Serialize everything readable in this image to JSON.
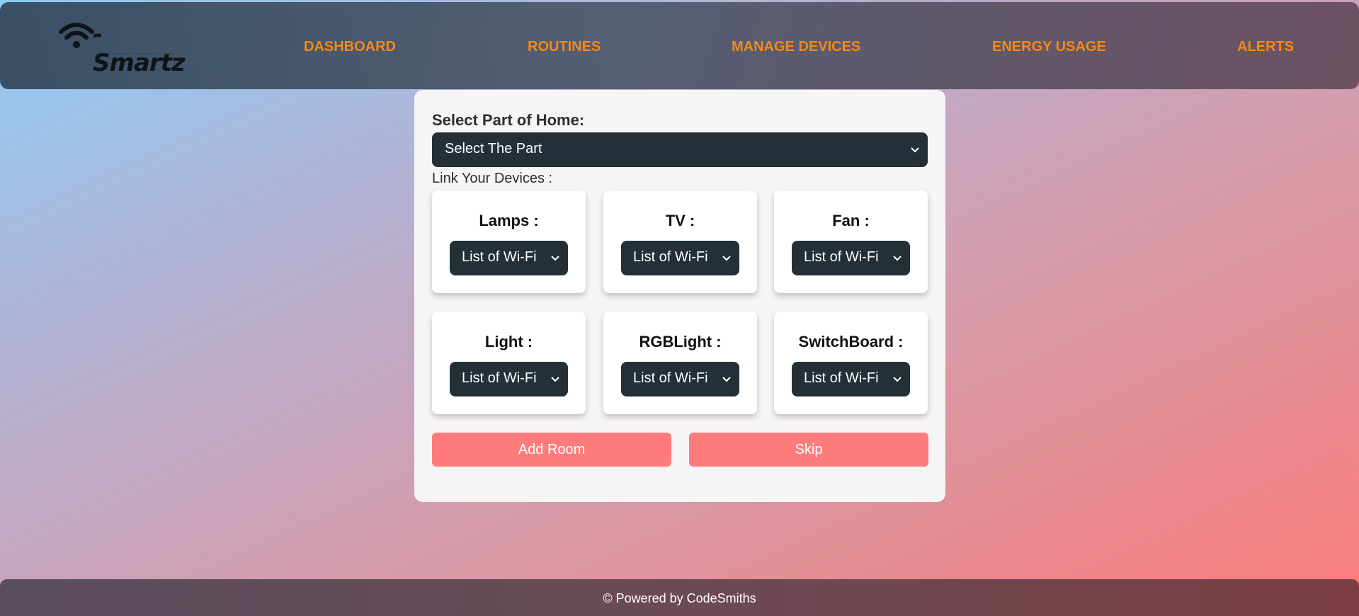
{
  "brand": {
    "name": "-Smartz",
    "logo_icon": "wifi-icon"
  },
  "nav": {
    "dashboard": "DASHBOARD",
    "routines": "ROUTINES",
    "manage_devices": "MANAGE DEVICES",
    "energy_usage": "ENERGY USAGE",
    "alerts": "ALERTS"
  },
  "form": {
    "part_label": "Select Part of Home:",
    "part_select": "Select The Part",
    "link_label": "Link Your Devices :",
    "devices": [
      {
        "label": "Lamps :",
        "select": "List of Wi-Fi"
      },
      {
        "label": "TV :",
        "select": "List of Wi-Fi"
      },
      {
        "label": "Fan :",
        "select": "List of Wi-Fi"
      },
      {
        "label": "Light :",
        "select": "List of Wi-Fi"
      },
      {
        "label": "RGBLight :",
        "select": "List of Wi-Fi"
      },
      {
        "label": "SwitchBoard :",
        "select": "List of Wi-Fi"
      }
    ],
    "add_room": "Add Room",
    "skip": "Skip"
  },
  "footer": {
    "text": "© Powered by CodeSmiths"
  },
  "colors": {
    "nav_link": "#f28a16",
    "select_bg": "#243037",
    "button_bg": "#fd7b7b",
    "panel_bg": "#f7f4f6"
  }
}
